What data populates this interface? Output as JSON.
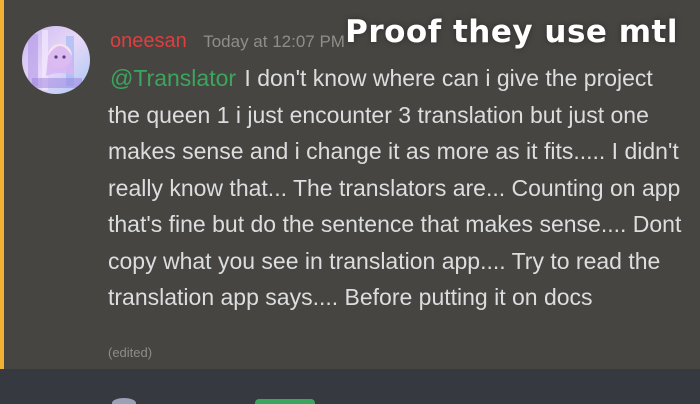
{
  "message": {
    "username": "oneesan",
    "timestamp": "Today at 12:07 PM",
    "mention": "@Translator",
    "body": " I don't know where can i give the project the queen 1 i just encounter 3 translation but just one makes sense and i change it as more as it fits..... I didn't really know that... The translators are... Counting on app that's fine but do the sentence that makes sense.... Dont copy what you see in translation app.... Try to read the translation app says.... Before putting it on docs",
    "edited_label": "(edited)"
  },
  "overlay": {
    "caption": "Proof they use mtl"
  },
  "colors": {
    "background": "#36393f",
    "highlight": "#474541",
    "accent_bar": "#f0b232",
    "username": "#e03e3e",
    "mention": "#3ba55d",
    "text": "#dcddde"
  },
  "icons": {
    "avatar": "anime-avatar-icon"
  }
}
